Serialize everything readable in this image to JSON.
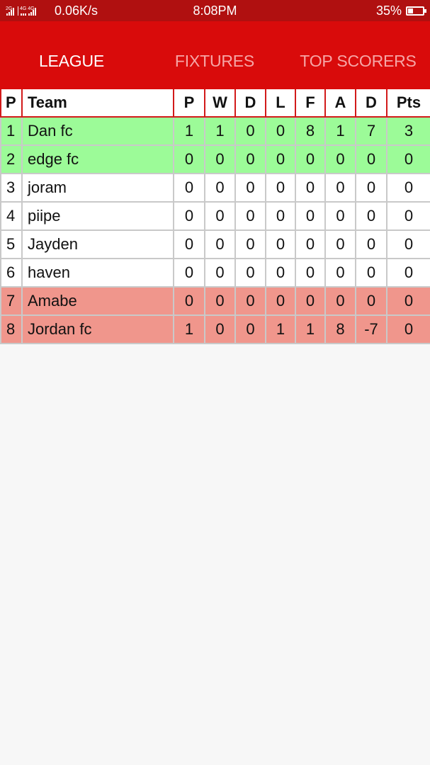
{
  "status_bar": {
    "network_label": "0.06K/s",
    "time": "8:08PM",
    "battery_percent": "35%",
    "battery_level": 0.35,
    "signal_badges": [
      "2G",
      "4G 4G"
    ]
  },
  "tabs": [
    {
      "label": "LEAGUE",
      "active": true
    },
    {
      "label": "FIXTURES",
      "active": false
    },
    {
      "label": "TOP SCORERS",
      "active": false
    }
  ],
  "table": {
    "headers": [
      "P",
      "Team",
      "P",
      "W",
      "D",
      "L",
      "F",
      "A",
      "D",
      "Pts"
    ],
    "rows": [
      {
        "pos": "1",
        "team": "Dan fc",
        "p": "1",
        "w": "1",
        "d": "0",
        "l": "0",
        "f": "8",
        "a": "1",
        "gd": "7",
        "pts": "3",
        "zone": "promotion"
      },
      {
        "pos": "2",
        "team": "edge fc",
        "p": "0",
        "w": "0",
        "d": "0",
        "l": "0",
        "f": "0",
        "a": "0",
        "gd": "0",
        "pts": "0",
        "zone": "promotion"
      },
      {
        "pos": "3",
        "team": "joram",
        "p": "0",
        "w": "0",
        "d": "0",
        "l": "0",
        "f": "0",
        "a": "0",
        "gd": "0",
        "pts": "0",
        "zone": "neutral"
      },
      {
        "pos": "4",
        "team": "piipe",
        "p": "0",
        "w": "0",
        "d": "0",
        "l": "0",
        "f": "0",
        "a": "0",
        "gd": "0",
        "pts": "0",
        "zone": "neutral"
      },
      {
        "pos": "5",
        "team": "Jayden",
        "p": "0",
        "w": "0",
        "d": "0",
        "l": "0",
        "f": "0",
        "a": "0",
        "gd": "0",
        "pts": "0",
        "zone": "neutral"
      },
      {
        "pos": "6",
        "team": "haven",
        "p": "0",
        "w": "0",
        "d": "0",
        "l": "0",
        "f": "0",
        "a": "0",
        "gd": "0",
        "pts": "0",
        "zone": "neutral"
      },
      {
        "pos": "7",
        "team": "Amabe",
        "p": "0",
        "w": "0",
        "d": "0",
        "l": "0",
        "f": "0",
        "a": "0",
        "gd": "0",
        "pts": "0",
        "zone": "relegation"
      },
      {
        "pos": "8",
        "team": "Jordan fc",
        "p": "1",
        "w": "0",
        "d": "0",
        "l": "1",
        "f": "1",
        "a": "8",
        "gd": "-7",
        "pts": "0",
        "zone": "relegation"
      }
    ]
  },
  "colors": {
    "status_bar": "#b01010",
    "tab_bar": "#d90b0b",
    "promotion_row": "#9cfb98",
    "relegation_row": "#f0968c",
    "neutral_row": "#ffffff"
  }
}
